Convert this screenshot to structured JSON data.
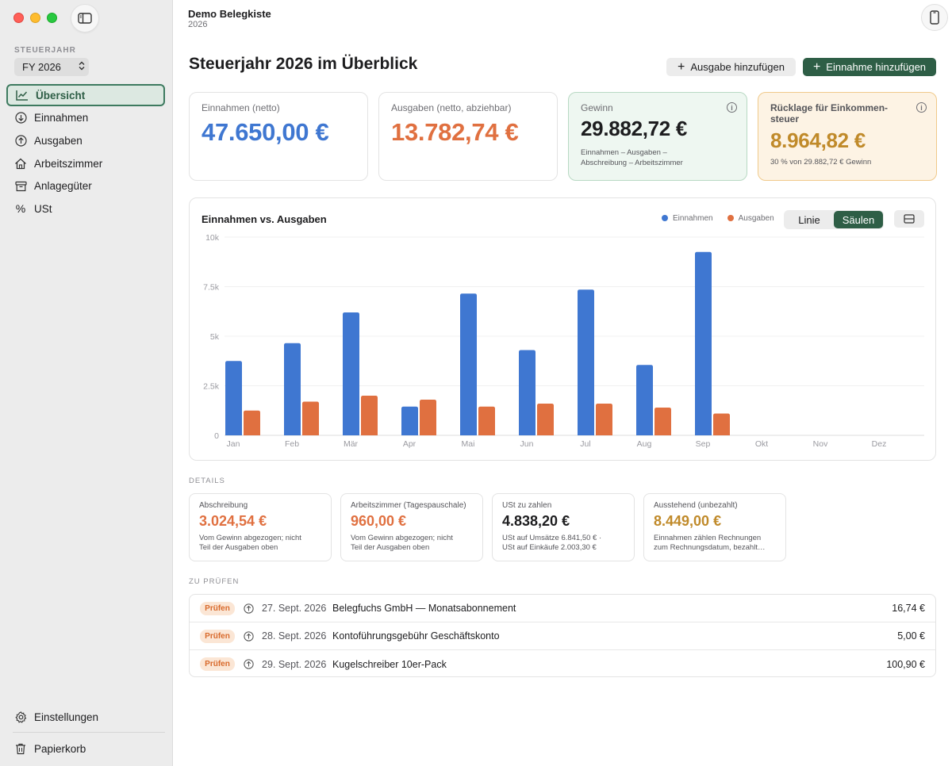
{
  "sidebar": {
    "section_label": "STEUERJAHR",
    "year_value": "FY 2026",
    "items": [
      {
        "label": "Übersicht",
        "icon": "chart-line-icon",
        "active": true
      },
      {
        "label": "Einnahmen",
        "icon": "arrow-down-circle-icon"
      },
      {
        "label": "Ausgaben",
        "icon": "arrow-up-circle-icon"
      },
      {
        "label": "Arbeitszimmer",
        "icon": "house-icon"
      },
      {
        "label": "Anlagegüter",
        "icon": "archive-box-icon"
      },
      {
        "label": "USt",
        "icon": "percent-icon"
      }
    ],
    "settings_label": "Einstellungen",
    "trash_label": "Papierkorb"
  },
  "header": {
    "app_title": "Demo Belegkiste",
    "app_subtitle": "2026",
    "page_title": "Steuerjahr 2026 im Überblick",
    "add_expense_label": "Ausgabe hinzufügen",
    "add_income_label": "Einnahme hinzufügen"
  },
  "stats": {
    "income": {
      "label": "Einnahmen (netto)",
      "value": "47.650,00 €",
      "color": "#3f77d1"
    },
    "expenses": {
      "label": "Ausgaben (netto, abziehbar)",
      "value": "13.782,74 €",
      "color": "#e07040"
    },
    "profit": {
      "label": "Gewinn",
      "value": "29.882,72 €",
      "sub": "Einnahmen – Ausgaben – Abschreibung – Arbeitszimmer"
    },
    "reserve": {
      "label": "Rücklage für Einkommen-steuer",
      "value": "8.964,82 €",
      "sub": "30 % von 29.882,72 € Gewinn",
      "color": "#c08a2a"
    }
  },
  "chart": {
    "title": "Einnahmen vs. Ausgaben",
    "toggle_line": "Linie",
    "toggle_bars": "Säulen"
  },
  "chart_data": {
    "type": "bar",
    "categories": [
      "Jan",
      "Feb",
      "Mär",
      "Apr",
      "Mai",
      "Jun",
      "Jul",
      "Aug",
      "Sep",
      "Okt",
      "Nov",
      "Dez"
    ],
    "series": [
      {
        "name": "Einnahmen",
        "color": "#3f77d1",
        "values": [
          3750,
          4650,
          6200,
          1450,
          7150,
          4300,
          7350,
          3550,
          9250,
          0,
          0,
          0
        ]
      },
      {
        "name": "Ausgaben",
        "color": "#e07040",
        "values": [
          1250,
          1700,
          2000,
          1800,
          1450,
          1600,
          1600,
          1400,
          1100,
          0,
          0,
          0
        ]
      }
    ],
    "ylim": [
      0,
      10000
    ],
    "y_ticks": [
      0,
      2500,
      5000,
      7500,
      10000
    ],
    "y_tick_labels": [
      "0",
      "2.5k",
      "5k",
      "7.5k",
      "10k"
    ],
    "grid": true,
    "legend_position": "top-right"
  },
  "details": {
    "section_label": "DETAILS",
    "cards": [
      {
        "label": "Abschreibung",
        "value": "3.024,54 €",
        "sub1": "Vom Gewinn abgezogen; nicht",
        "sub2": "Teil der Ausgaben oben",
        "color": "#e07040"
      },
      {
        "label": "Arbeitszimmer (Tagespauschale)",
        "value": "960,00 €",
        "sub1": "Vom Gewinn abgezogen; nicht",
        "sub2": "Teil der Ausgaben oben",
        "color": "#e07040"
      },
      {
        "label": "USt zu zahlen",
        "value": "4.838,20 €",
        "sub1": "USt auf Umsätze 6.841,50 € ·",
        "sub2": "USt auf Einkäufe 2.003,30 €",
        "color": "#1d1d1f"
      },
      {
        "label": "Ausstehend (unbezahlt)",
        "value": "8.449,00 €",
        "sub1": "Einnahmen zählen Rechnungen",
        "sub2": "zum Rechnungsdatum, bezahlt…",
        "color": "#c08a2a"
      }
    ]
  },
  "review": {
    "section_label": "ZU PRÜFEN",
    "rows": [
      {
        "badge": "Prüfen",
        "date": "27. Sept. 2026",
        "desc": "Belegfuchs GmbH — Monatsabonnement",
        "amount": "16,74 €"
      },
      {
        "badge": "Prüfen",
        "date": "28. Sept. 2026",
        "desc": "Kontoführungsgebühr Geschäftskonto",
        "amount": "5,00 €"
      },
      {
        "badge": "Prüfen",
        "date": "29. Sept. 2026",
        "desc": "Kugelschreiber 10er-Pack",
        "amount": "100,90 €"
      }
    ]
  }
}
